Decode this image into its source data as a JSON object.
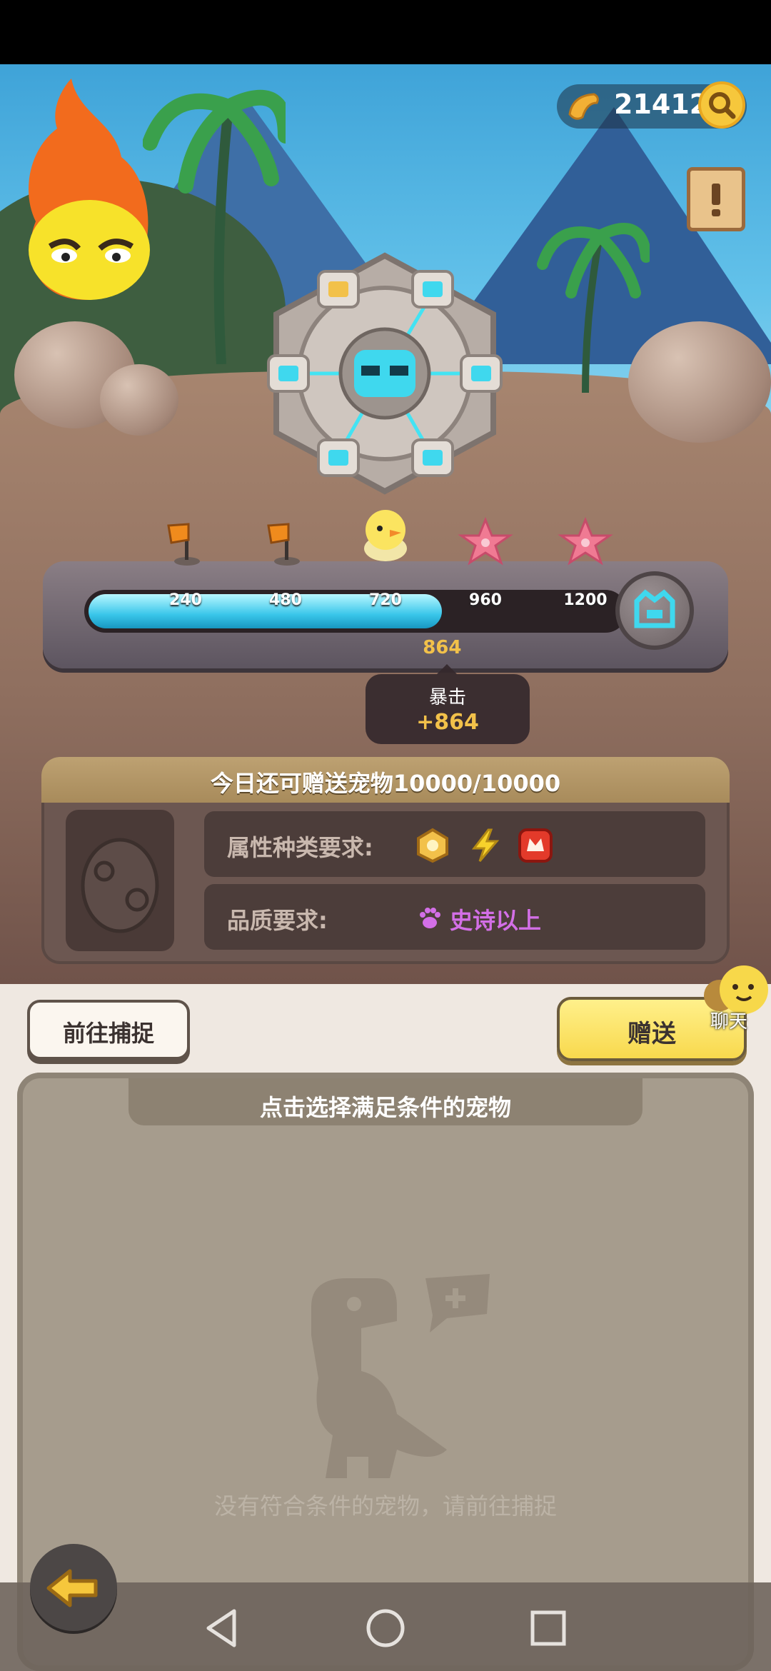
{
  "currency": {
    "amount": "21412",
    "icon": "bone-coin-icon"
  },
  "buttons": {
    "search_icon": "search-icon",
    "quest_icon": "quest-scroll-icon"
  },
  "progress": {
    "current": "864",
    "max": 1200,
    "value": 864,
    "ticks": [
      "240",
      "480",
      "720",
      "960",
      "1200"
    ],
    "milestones": [
      "flag-icon",
      "flag-icon",
      "chick-pet-icon",
      "starfish-icon",
      "starfish-icon"
    ]
  },
  "crit_tooltip": {
    "title": "暴击",
    "value": "+864"
  },
  "requirements": {
    "header": "今日还可赠送宠物10000/10000",
    "type_label": "属性种类要求:",
    "type_icons": [
      "earth-type-icon",
      "lightning-type-icon",
      "fire-type-icon"
    ],
    "quality_label": "品质要求:",
    "quality_value": "史诗以上",
    "quality_icon": "paw-icon",
    "egg_icon": "egg-icon"
  },
  "actions": {
    "capture": "前往捕捉",
    "gift": "赠送",
    "chat": "聊天"
  },
  "pet_list": {
    "header": "点击选择满足条件的宠物",
    "empty_message": "没有符合条件的宠物，请前往捕捉"
  },
  "colors": {
    "progress": "#39c6ea",
    "gold": "#f2c14a",
    "epic": "#d36fe7"
  }
}
